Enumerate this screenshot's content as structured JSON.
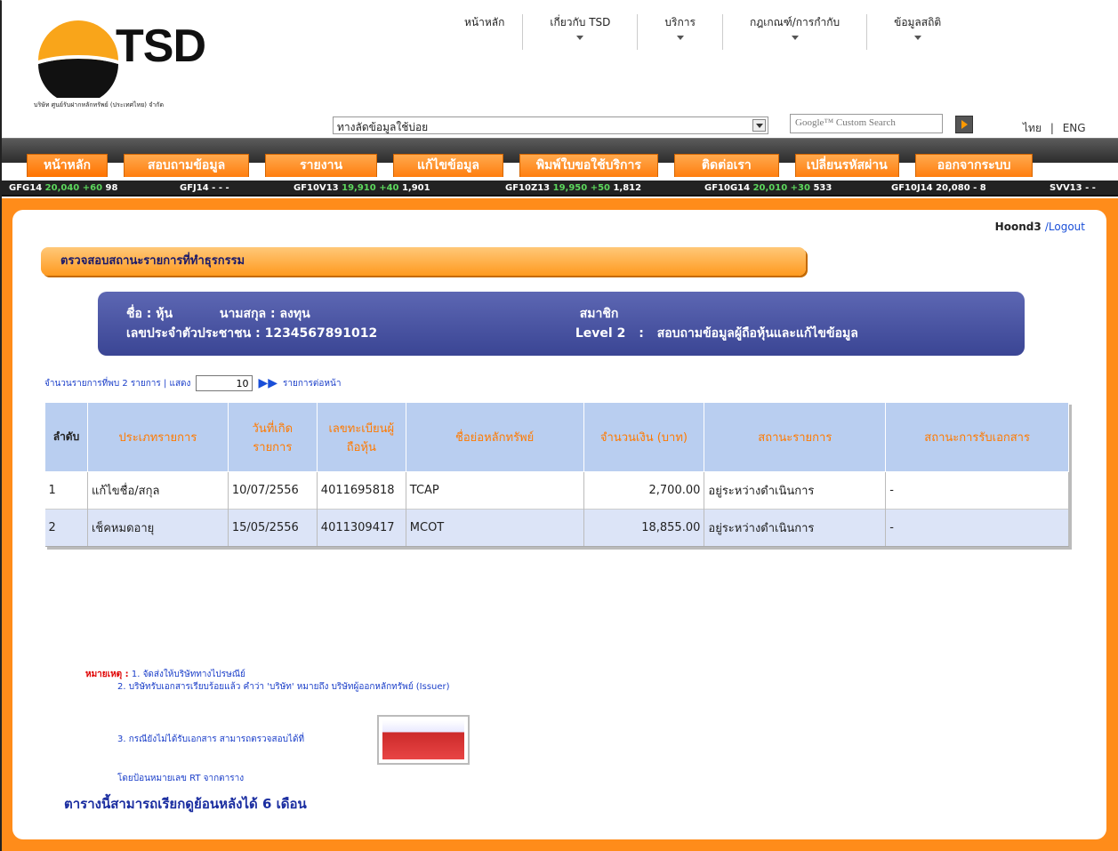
{
  "brand": {
    "name": "TSD",
    "company": "บริษัท ศูนย์รับฝากหลักทรัพย์ (ประเทศไทย) จำกัด",
    "colors": {
      "accent": "#ff8c1a",
      "nav_box": "#3a4594"
    }
  },
  "topnav": [
    {
      "label": "หน้าหลัก"
    },
    {
      "label": "เกี่ยวกับ TSD"
    },
    {
      "label": "บริการ"
    },
    {
      "label": "กฎเกณฑ์/การกำกับ"
    },
    {
      "label": "ข้อมูลสถิติ"
    }
  ],
  "quicklink": {
    "selected": "ทางลัดข้อมูลใช้บ่อย"
  },
  "search": {
    "placeholder": "Google™ Custom Search"
  },
  "lang": {
    "thai": "ไทย",
    "sep": "|",
    "eng": "ENG"
  },
  "menu": [
    {
      "label": "หน้าหลัก"
    },
    {
      "label": "สอบถามข้อมูล"
    },
    {
      "label": "รายงาน"
    },
    {
      "label": "แก้ไขข้อมูล"
    },
    {
      "label": "พิมพ์ใบขอใช้บริการ"
    },
    {
      "label": "ติดต่อเรา"
    },
    {
      "label": "เปลี่ยนรหัสผ่าน"
    },
    {
      "label": "ออกจากระบบ"
    }
  ],
  "ticker": [
    {
      "sym": "GFG14",
      "price": "20,040",
      "chg": "+60",
      "vol": "98"
    },
    {
      "sym": "GFJ14",
      "price": "-",
      "chg": "-",
      "vol": "-"
    },
    {
      "sym": "GF10V13",
      "price": "19,910",
      "chg": "+40",
      "vol": "1,901"
    },
    {
      "sym": "GF10Z13",
      "price": "19,950",
      "chg": "+50",
      "vol": "1,812"
    },
    {
      "sym": "GF10G14",
      "price": "20,010",
      "chg": "+30",
      "vol": "533"
    },
    {
      "sym": "GF10J14",
      "price": "20,080",
      "chg": "-",
      "vol": "8"
    },
    {
      "sym": "SVV13",
      "price": "-",
      "chg": "-",
      "vol": ""
    }
  ],
  "user": {
    "name": "Hoond3",
    "logout": "/Logout"
  },
  "section": {
    "title": "ตรวจสอบสถานะรายการที่ทำธุรกรรม"
  },
  "info": {
    "name": "ชื่อ : หุ้น",
    "surname": "นามสกุล : ลงทุน",
    "member": "สมาชิก",
    "idlabel": "เลขประจำตัวประชาชน : 1234567891012",
    "level": "Level 2",
    "levelsep": ":",
    "leveldesc": "สอบถามข้อมูลผู้ถือหุ้นและแก้ไขข้อมูล"
  },
  "pager": {
    "found": "จำนวนรายการที่พบ 2 รายการ | แสดง",
    "per_page": "10",
    "suffix": "รายการต่อหน้า"
  },
  "table": {
    "headers": [
      "ลำดับ",
      "ประเภทรายการ",
      "วันที่เกิดรายการ",
      "เลขทะเบียนผู้ถือหุ้น",
      "ชื่อย่อหลักทรัพย์",
      "จำนวนเงิน (บาท)",
      "สถานะรายการ",
      "สถานะการรับเอกสาร"
    ],
    "rows": [
      [
        "1",
        "แก้ไขชื่อ/สกุล",
        "10/07/2556",
        "4011695818",
        "TCAP",
        "2,700.00",
        "อยู่ระหว่างดำเนินการ",
        "-"
      ],
      [
        "2",
        "เช็คหมดอายุ",
        "15/05/2556",
        "4011309417",
        "MCOT",
        "18,855.00",
        "อยู่ระหว่างดำเนินการ",
        "-"
      ]
    ]
  },
  "notes": {
    "label": "หมายเหตุ :",
    "n1": "1. จัดส่งให้บริษัททางไปรษณีย์",
    "n2": "2. บริษัทรับเอกสารเรียบร้อยแล้ว คำว่า 'บริษัท' หมายถึง บริษัทผู้ออกหลักทรัพย์ (Issuer)",
    "n3": "3. กรณียังไม่ได้รับเอกสาร สามารถตรวจสอบได้ที่",
    "n4": "โดยป้อนหมายเลข RT จากตาราง",
    "footer": "ตารางนี้สามารถเรียกดูย้อนหลังได้ 6 เดือน"
  }
}
